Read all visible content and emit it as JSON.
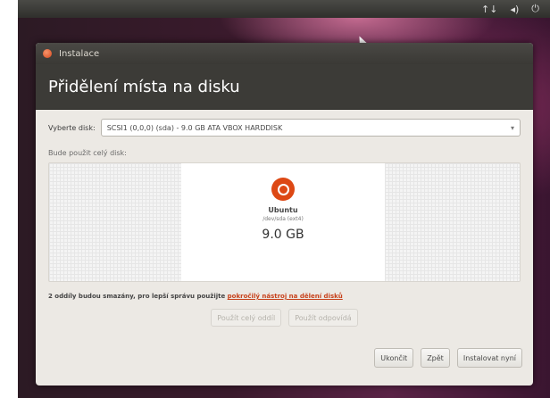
{
  "topbar": {
    "network_icon": "↑↓",
    "sound_icon": "◂)",
    "power_icon": "⏻"
  },
  "window": {
    "title": "Instalace",
    "header": "Přidělení místa na disku"
  },
  "disk_select": {
    "label": "Vyberte disk:",
    "value": "SCSI1 (0,0,0) (sda) - 9.0 GB ATA VBOX HARDDISK"
  },
  "whole_disk_label": "Bude použit celý disk:",
  "partition": {
    "name": "Ubuntu",
    "device": "/dev/sda (ext4)",
    "size": "9.0 GB"
  },
  "warning": {
    "text": "2 oddíly budou smazány, pro lepší správu použijte ",
    "link": "pokročilý nástroj na dělení disků"
  },
  "mid_buttons": {
    "use_all": "Použít celý oddíl",
    "use_part": "Použít odpovídá"
  },
  "bottom_buttons": {
    "quit": "Ukončit",
    "back": "Zpět",
    "install": "Instalovat nyní"
  },
  "colors": {
    "ubuntu_orange": "#dd4814",
    "header_bg": "#3c3b37",
    "window_bg": "#ece9e4"
  }
}
